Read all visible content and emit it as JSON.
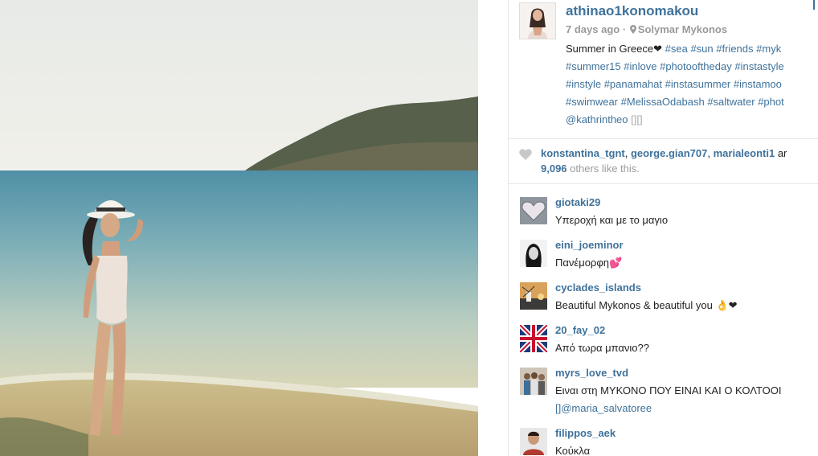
{
  "post": {
    "username": "athinao1konomakou",
    "time_ago": "7 days ago",
    "dot": "·",
    "location": "Solymar Mykonos",
    "caption_lines": [
      [
        {
          "t": "text",
          "v": "Summer in Greece❤ "
        },
        {
          "t": "tag",
          "v": "#sea"
        },
        {
          "t": "text",
          "v": " "
        },
        {
          "t": "tag",
          "v": "#sun"
        },
        {
          "t": "text",
          "v": " "
        },
        {
          "t": "tag",
          "v": "#friends"
        },
        {
          "t": "text",
          "v": " "
        },
        {
          "t": "tag",
          "v": "#myk"
        }
      ],
      [
        {
          "t": "tag",
          "v": "#summer15"
        },
        {
          "t": "text",
          "v": " "
        },
        {
          "t": "tag",
          "v": "#inlove"
        },
        {
          "t": "text",
          "v": " "
        },
        {
          "t": "tag",
          "v": "#photooftheday"
        },
        {
          "t": "text",
          "v": " "
        },
        {
          "t": "tag",
          "v": "#instastyle"
        }
      ],
      [
        {
          "t": "tag",
          "v": "#instyle"
        },
        {
          "t": "text",
          "v": " "
        },
        {
          "t": "tag",
          "v": "#panamahat"
        },
        {
          "t": "text",
          "v": " "
        },
        {
          "t": "tag",
          "v": "#instasummer"
        },
        {
          "t": "text",
          "v": " "
        },
        {
          "t": "tag",
          "v": "#instamoo"
        }
      ],
      [
        {
          "t": "tag",
          "v": "#swimwear"
        },
        {
          "t": "text",
          "v": " "
        },
        {
          "t": "tag",
          "v": "#MelissaOdabash"
        },
        {
          "t": "text",
          "v": " "
        },
        {
          "t": "tag",
          "v": "#saltwater"
        },
        {
          "t": "text",
          "v": " "
        },
        {
          "t": "tag",
          "v": "#phot"
        }
      ],
      [
        {
          "t": "mention",
          "v": "@kathrintheo"
        },
        {
          "t": "text",
          "v": " "
        },
        {
          "t": "glyph",
          "v": "[][]"
        }
      ]
    ],
    "icons": {
      "location": "pin-icon",
      "like": "heart-icon"
    }
  },
  "likes": {
    "users": [
      "konstantina_tgnt",
      "george.gian707",
      "marialeonti1"
    ],
    "separator": ",",
    "trailing": "ar",
    "count": "9,096",
    "others_text": "others like this."
  },
  "comments": [
    {
      "user": "giotaki29",
      "text": "Υπεροχή και με το μαγιο",
      "avatar": "heart-avatar",
      "avatar_color": "#9aa0a8"
    },
    {
      "user": "eini_joeminor",
      "text": "Πανέμορφη💕",
      "avatar": "portrait-avatar",
      "avatar_color": "#222222"
    },
    {
      "user": "cyclades_islands",
      "text": "Beautiful Mykonos & beautiful you 👌❤",
      "avatar": "windmill-avatar",
      "avatar_color": "#c9a36a"
    },
    {
      "user": "20_fay_02",
      "text": "Από τωρα μπανιο??",
      "avatar": "union-jack-avatar",
      "avatar_color": "#1f3a7a"
    },
    {
      "user": "myrs_love_tvd",
      "text": "Ειναι στη ΜΥΚΟΝΟ ΠΟΥ ΕΙΝΑΙ ΚΑΙ Ο ΚΟΛΤΟΟΙ",
      "text2": "[]@maria_salvatoree",
      "avatar": "group-avatar",
      "avatar_color": "#8a7f70"
    },
    {
      "user": "filippos_aek",
      "text": "Κούκλα",
      "avatar": "boy-avatar",
      "avatar_color": "#b04030"
    }
  ],
  "colors": {
    "link": "#3f729b",
    "muted": "#9a9a9a"
  }
}
